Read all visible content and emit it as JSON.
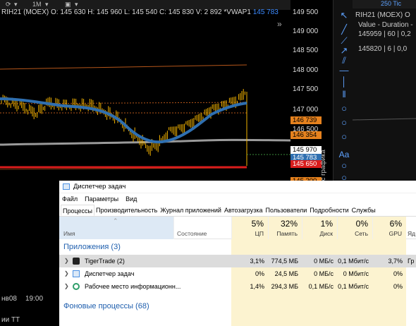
{
  "chart": {
    "ticker": "RIH21 (MOEX)",
    "ohlcv": "O: 145 630  H: 145 960  L: 145 540  C: 145 830  V: 2 892  *VWAP1",
    "vwap_value": "145 783",
    "toolbar_label": "1M",
    "time_label": "19:00",
    "date_label": "нв08",
    "bottom_label": "ии ТТ",
    "vertical_label": "ала с графика",
    "colors": {
      "bg": "#000000",
      "candle": "#f5b400",
      "vwap": "#2f6fb0",
      "sma": "#a0a0a0",
      "level_red": "#d91c1c",
      "band": "#c0601a"
    }
  },
  "price_scale": {
    "ticks": [
      "149 500",
      "149 000",
      "148 500",
      "148 000",
      "147 500",
      "147 000",
      "146 500"
    ],
    "tags": [
      {
        "text": "146 739",
        "bg": "#e6821e",
        "fg": "#000"
      },
      {
        "text": "146 354",
        "bg": "#e6821e",
        "fg": "#000"
      },
      {
        "text": "145 970",
        "bg": "#ffffff",
        "fg": "#000"
      },
      {
        "text": "145 783",
        "bg": "#2f6fb0",
        "fg": "#fff"
      },
      {
        "text": "145 650",
        "bg": "#d91c1c",
        "fg": "#fff"
      },
      {
        "text": "145 200",
        "bg": "#e6821e",
        "fg": "#000"
      }
    ]
  },
  "tape": {
    "title": "RIH21 (MOEX) O",
    "header": "Value - Duration -",
    "rows": [
      "145959 | 60 | 0,2",
      "145820 |  6 | 0,0"
    ],
    "ticks_label": "250 Tic"
  },
  "task_manager": {
    "title": "Диспетчер задач",
    "menu": [
      "Файл",
      "Параметры",
      "Вид"
    ],
    "tabs": [
      "Процессы",
      "Производительность",
      "Журнал приложений",
      "Автозагрузка",
      "Пользователи",
      "Подробности",
      "Службы"
    ],
    "active_tab": 0,
    "columns": {
      "name": "Имя",
      "state": "Состояние",
      "cpu": {
        "pct": "5%",
        "label": "ЦП"
      },
      "mem": {
        "pct": "32%",
        "label": "Память"
      },
      "disk": {
        "pct": "1%",
        "label": "Диск"
      },
      "net": {
        "pct": "0%",
        "label": "Сеть"
      },
      "gpu": {
        "pct": "6%",
        "label": "GPU"
      },
      "gpu_engine": {
        "pct": "",
        "label": "Яд"
      }
    },
    "group_apps": "Приложения (3)",
    "group_bg": "Фоновые процессы (68)",
    "processes": [
      {
        "name": "TigerTrade (2)",
        "cpu": "3,1%",
        "mem": "774,5 МБ",
        "disk": "0 МБ/с",
        "net": "0,1 Мбит/с",
        "gpu": "3,7%",
        "engine": "Гр"
      },
      {
        "name": "Диспетчер задач",
        "cpu": "0%",
        "mem": "24,5 МБ",
        "disk": "0 МБ/с",
        "net": "0 Мбит/с",
        "gpu": "0%",
        "engine": ""
      },
      {
        "name": "Рабочее место информационн...",
        "cpu": "1,4%",
        "mem": "294,3 МБ",
        "disk": "0,1 МБ/с",
        "net": "0,1 Мбит/с",
        "gpu": "0%",
        "engine": ""
      }
    ]
  }
}
